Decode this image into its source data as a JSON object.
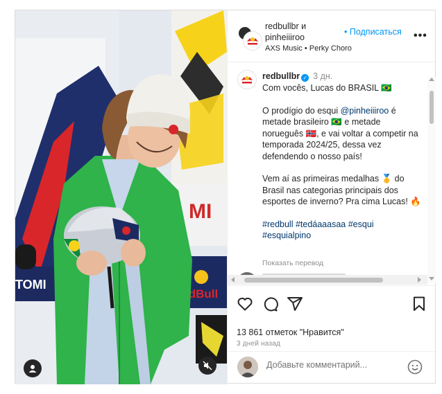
{
  "header": {
    "names_line1": "redbullbr и",
    "names_line2": "pinheiiiroo",
    "follow_label": "• Подписаться",
    "more_label": "•••",
    "music": "AXS Music • Perky Choro"
  },
  "caption": {
    "username": "redbullbr",
    "time": "3 дн.",
    "line1": "Com vocês, Lucas do BRASIL 🇧🇷",
    "p2_a": "O prodígio do esqui ",
    "mention": "@pinheiiiroo",
    "p2_b": " é metade brasileiro 🇧🇷 e metade norueguês 🇳🇴, e vai voltar a competir na temporada 2024/25, dessa vez defendendo o nosso país!",
    "p3": "Vem aí as primeiras medalhas 🥇 do Brasil nas categorias principais dos esportes de inverno? Pra cima Lucas! 🔥",
    "hashtags": "#redbull #tedáaaasaa #esqui #esquialpino",
    "translate": "Показать перевод"
  },
  "stats": {
    "likes": "13 861 отметок \"Нравится\"",
    "ago": "3 дней назад"
  },
  "comment_box": {
    "placeholder": "Добавьте комментарий..."
  },
  "colors": {
    "accent": "#0095f6",
    "link": "#00376b",
    "sweater": "#2fb34a",
    "beanie": "#f2f0ea"
  },
  "icons": {
    "like": "heart-icon",
    "comment": "comment-icon",
    "share": "send-icon",
    "save": "bookmark-icon",
    "emoji": "smiley-icon",
    "mute": "muted-speaker-icon",
    "tagged": "user-icon"
  }
}
